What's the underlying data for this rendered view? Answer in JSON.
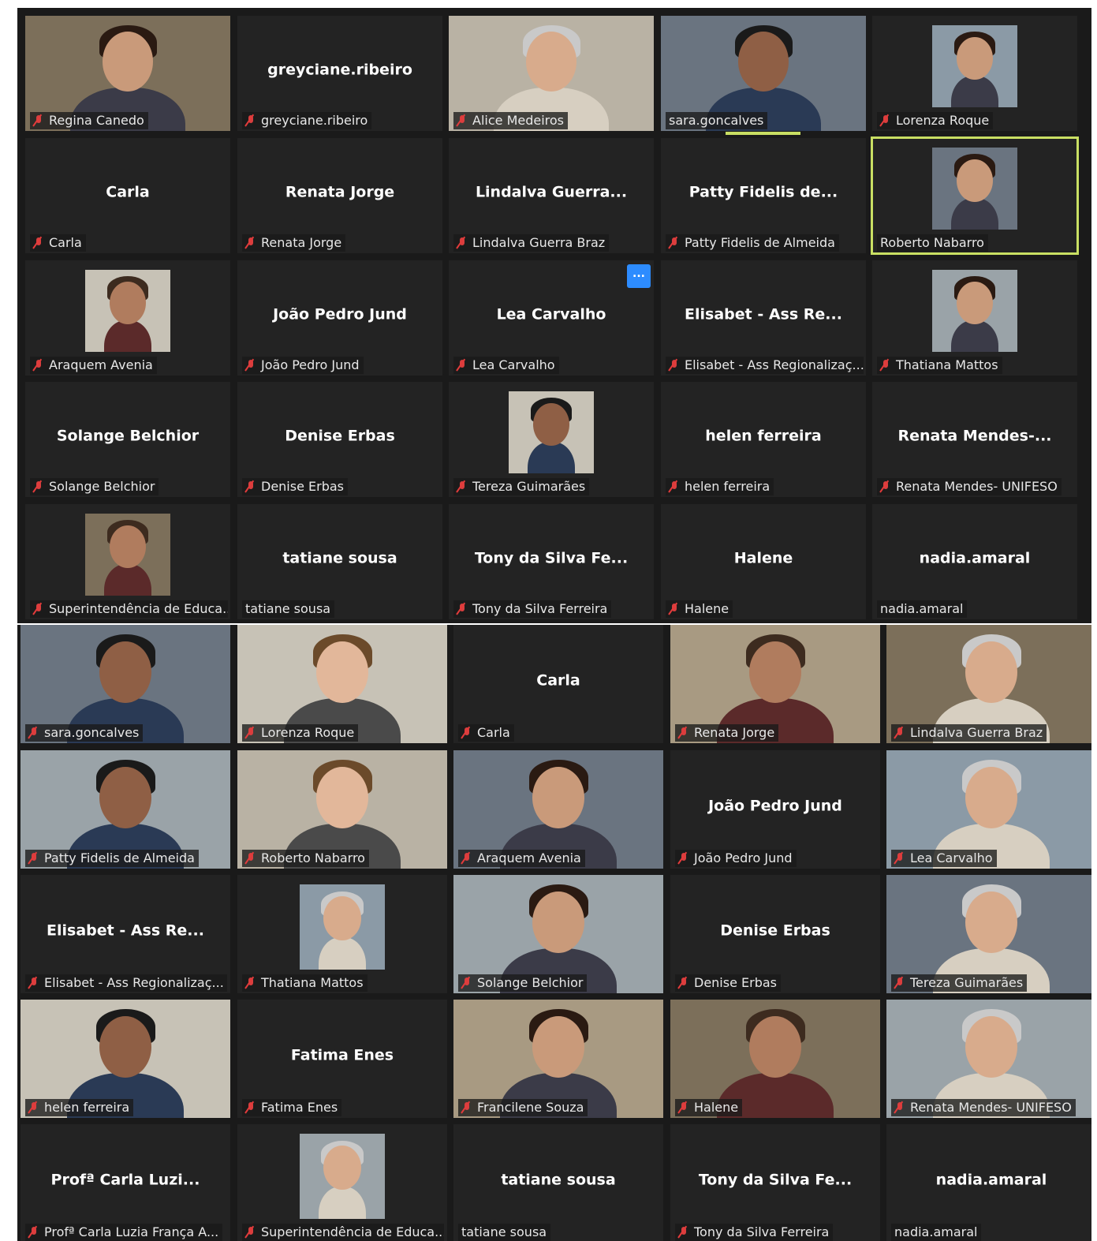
{
  "panel_top": {
    "tiles": [
      {
        "center": "",
        "label": "Regina Canedo",
        "muted": true,
        "video": "camera"
      },
      {
        "center": "greyciane.ribeiro",
        "label": "greyciane.ribeiro",
        "muted": true,
        "video": "none"
      },
      {
        "center": "",
        "label": "Alice Medeiros",
        "muted": true,
        "video": "camera"
      },
      {
        "center": "",
        "label": "sara.goncalves",
        "muted": false,
        "video": "camera"
      },
      {
        "center": "",
        "label": "Lorenza Roque",
        "muted": true,
        "video": "photo"
      },
      {
        "center": "Carla",
        "label": "Carla",
        "muted": true,
        "video": "none"
      },
      {
        "center": "Renata Jorge",
        "label": "Renata Jorge",
        "muted": true,
        "video": "none"
      },
      {
        "center": "Lindalva Guerra...",
        "label": "Lindalva Guerra Braz",
        "muted": true,
        "video": "none"
      },
      {
        "center": "Patty Fidelis de...",
        "label": "Patty Fidelis de Almeida",
        "muted": true,
        "video": "none"
      },
      {
        "center": "",
        "label": "Roberto Nabarro",
        "muted": false,
        "video": "photo",
        "active": true
      },
      {
        "center": "",
        "label": "Araquem Avenia",
        "muted": true,
        "video": "photo"
      },
      {
        "center": "João Pedro Jund",
        "label": "João Pedro Jund",
        "muted": true,
        "video": "none"
      },
      {
        "center": "Lea Carvalho",
        "label": "Lea Carvalho",
        "muted": true,
        "video": "none",
        "more": "..."
      },
      {
        "center": "Elisabet - Ass Re...",
        "label": "Elisabet - Ass Regionalizaç...",
        "muted": true,
        "video": "none"
      },
      {
        "center": "",
        "label": "Thatiana Mattos",
        "muted": true,
        "video": "photo"
      },
      {
        "center": "Solange Belchior",
        "label": "Solange Belchior",
        "muted": true,
        "video": "none"
      },
      {
        "center": "Denise Erbas",
        "label": "Denise Erbas",
        "muted": true,
        "video": "none"
      },
      {
        "center": "",
        "label": "Tereza Guimarães",
        "muted": true,
        "video": "photo"
      },
      {
        "center": "helen ferreira",
        "label": "helen ferreira",
        "muted": true,
        "video": "none"
      },
      {
        "center": "Renata Mendes-...",
        "label": "Renata Mendes- UNIFESO",
        "muted": true,
        "video": "none"
      },
      {
        "center": "",
        "label": "Superintendência de Educa...",
        "muted": true,
        "video": "photo"
      },
      {
        "center": "tatiane sousa",
        "label": "tatiane sousa",
        "muted": false,
        "video": "none"
      },
      {
        "center": "Tony da Silva Fe...",
        "label": "Tony da Silva Ferreira",
        "muted": true,
        "video": "none"
      },
      {
        "center": "Halene",
        "label": "Halene",
        "muted": true,
        "video": "none"
      },
      {
        "center": "nadia.amaral",
        "label": "nadia.amaral",
        "muted": false,
        "video": "none"
      }
    ]
  },
  "panel_bottom": {
    "tiles": [
      {
        "center": "",
        "label": "sara.goncalves",
        "muted": true,
        "video": "camera"
      },
      {
        "center": "",
        "label": "Lorenza Roque",
        "muted": true,
        "video": "camera"
      },
      {
        "center": "Carla",
        "label": "Carla",
        "muted": true,
        "video": "none"
      },
      {
        "center": "",
        "label": "Renata Jorge",
        "muted": true,
        "video": "camera"
      },
      {
        "center": "",
        "label": "Lindalva Guerra Braz",
        "muted": true,
        "video": "camera"
      },
      {
        "center": "",
        "label": "Patty Fidelis de Almeida",
        "muted": true,
        "video": "camera"
      },
      {
        "center": "",
        "label": "Roberto Nabarro",
        "muted": true,
        "video": "camera"
      },
      {
        "center": "",
        "label": "Araquem Avenia",
        "muted": true,
        "video": "camera"
      },
      {
        "center": "João Pedro Jund",
        "label": "João Pedro Jund",
        "muted": true,
        "video": "none"
      },
      {
        "center": "",
        "label": "Lea Carvalho",
        "muted": true,
        "video": "camera"
      },
      {
        "center": "Elisabet - Ass Re...",
        "label": "Elisabet - Ass Regionalizaç...",
        "muted": true,
        "video": "none"
      },
      {
        "center": "",
        "label": "Thatiana Mattos",
        "muted": true,
        "video": "photo"
      },
      {
        "center": "",
        "label": "Solange Belchior",
        "muted": true,
        "video": "camera"
      },
      {
        "center": "Denise Erbas",
        "label": "Denise Erbas",
        "muted": true,
        "video": "none"
      },
      {
        "center": "",
        "label": "Tereza Guimarães",
        "muted": true,
        "video": "camera"
      },
      {
        "center": "",
        "label": "helen ferreira",
        "muted": true,
        "video": "camera"
      },
      {
        "center": "Fatima Enes",
        "label": "Fatima Enes",
        "muted": true,
        "video": "none"
      },
      {
        "center": "",
        "label": "Francilene Souza",
        "muted": true,
        "video": "camera"
      },
      {
        "center": "",
        "label": "Halene",
        "muted": true,
        "video": "camera"
      },
      {
        "center": "",
        "label": "Renata Mendes- UNIFESO",
        "muted": true,
        "video": "camera"
      },
      {
        "center": "Profª Carla Luzi...",
        "label": "Profª Carla Luzia  França A...",
        "muted": true,
        "video": "none"
      },
      {
        "center": "",
        "label": "Superintendência de Educa...",
        "muted": true,
        "video": "photo"
      },
      {
        "center": "tatiane sousa",
        "label": "tatiane sousa",
        "muted": false,
        "video": "none"
      },
      {
        "center": "Tony da Silva Fe...",
        "label": "Tony da Silva Ferreira",
        "muted": true,
        "video": "none"
      },
      {
        "center": "nadia.amaral",
        "label": "nadia.amaral",
        "muted": false,
        "video": "none"
      }
    ]
  },
  "colors": {
    "active_speaker": "#c9df63",
    "tile_bg": "#232323",
    "muted_icon": "#e23b3b",
    "more_button": "#2d8cff"
  }
}
